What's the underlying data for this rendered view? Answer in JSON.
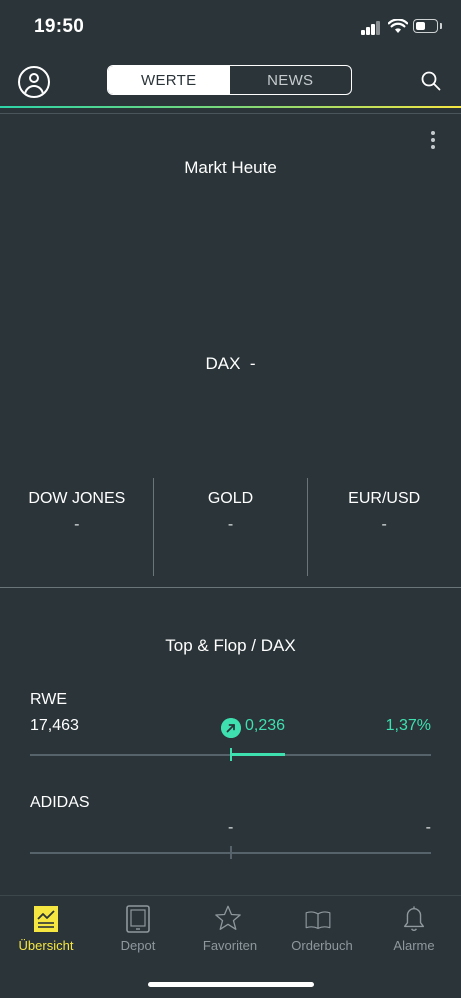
{
  "status_bar": {
    "time": "19:50"
  },
  "header": {
    "tabs": [
      {
        "label": "WERTE",
        "active": true
      },
      {
        "label": "NEWS",
        "active": false
      }
    ]
  },
  "markt": {
    "title": "Markt Heute",
    "dax_label": "DAX",
    "dax_value": "-",
    "indices": [
      {
        "name": "DOW JONES",
        "value": "-"
      },
      {
        "name": "GOLD",
        "value": "-"
      },
      {
        "name": "EUR/USD",
        "value": "-"
      }
    ]
  },
  "top_flop": {
    "title": "Top & Flop / DAX",
    "rows": [
      {
        "name": "RWE",
        "price": "17,463",
        "change": "0,236",
        "percent": "1,37%",
        "bar_fraction": 0.27
      },
      {
        "name": "ADIDAS",
        "price": "",
        "change": "-",
        "percent": "-",
        "bar_fraction": 0
      }
    ]
  },
  "tabbar": {
    "items": [
      {
        "label": "Übersicht",
        "icon": "overview-chart-icon",
        "active": true
      },
      {
        "label": "Depot",
        "icon": "tablet-icon",
        "active": false
      },
      {
        "label": "Favoriten",
        "icon": "star-icon",
        "active": false
      },
      {
        "label": "Orderbuch",
        "icon": "book-icon",
        "active": false
      },
      {
        "label": "Alarme",
        "icon": "bell-icon",
        "active": false
      }
    ]
  },
  "colors": {
    "background": "#2a3439",
    "accent_positive": "#3ee0b0",
    "accent_active_tab": "#f5e642"
  }
}
